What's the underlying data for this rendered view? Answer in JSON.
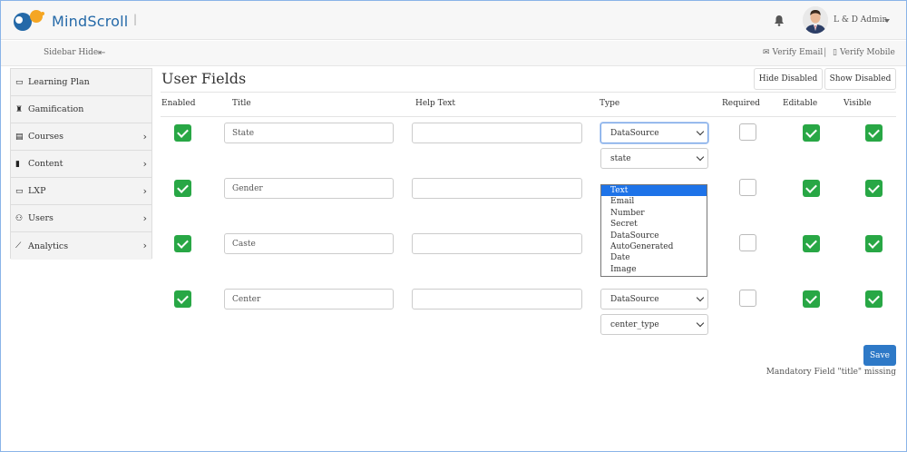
{
  "header": {
    "brand": "MindScroll",
    "separator": "|",
    "user_name": "L & D Admin"
  },
  "subbar": {
    "sidebar_hide": "Sidebar Hide",
    "verify_email": "Verify Email",
    "verify_separator": "|",
    "verify_mobile": "Verify Mobile"
  },
  "sidebar": {
    "items": [
      {
        "label": "Learning Plan",
        "icon": "book-icon"
      },
      {
        "label": "Gamification",
        "icon": "trophy-icon"
      },
      {
        "label": "Courses",
        "icon": "card-icon"
      },
      {
        "label": "Content",
        "icon": "file-icon"
      },
      {
        "label": "LXP",
        "icon": "book-icon"
      },
      {
        "label": "Users",
        "icon": "users-icon"
      },
      {
        "label": "Analytics",
        "icon": "chart-line-icon"
      }
    ]
  },
  "main": {
    "title": "User Fields",
    "hide_disabled": "Hide Disabled",
    "show_disabled": "Show Disabled",
    "columns": [
      "Enabled",
      "Title",
      "Help Text",
      "Type",
      "Required",
      "Editable",
      "Visible"
    ],
    "rows": [
      {
        "title": "State",
        "help": "",
        "type": "DataSource",
        "source": "state",
        "enabled": true,
        "required": false,
        "editable": true,
        "visible": true
      },
      {
        "title": "Gender",
        "help": "",
        "type": "Text",
        "enabled": true,
        "required": false,
        "editable": true,
        "visible": true
      },
      {
        "title": "Caste",
        "help": "",
        "type": "",
        "enabled": true,
        "required": false,
        "editable": true,
        "visible": true
      },
      {
        "title": "Center",
        "help": "",
        "type": "DataSource",
        "source": "center_type",
        "enabled": true,
        "required": false,
        "editable": true,
        "visible": true
      }
    ],
    "type_options": [
      "Text",
      "Email",
      "Number",
      "Secret",
      "DataSource",
      "AutoGenerated",
      "Date",
      "Image"
    ],
    "save": "Save",
    "error": "Mandatory Field \"title\" missing"
  },
  "colors": {
    "brand": "#2469a8",
    "check_green": "#28a745",
    "save_blue": "#2e79c7",
    "dropdown_selected": "#1e73e8"
  }
}
